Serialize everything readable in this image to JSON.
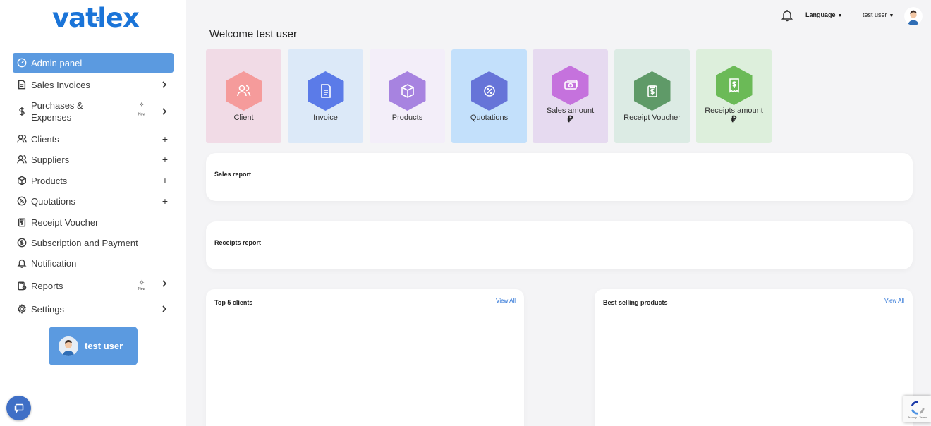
{
  "brand": {
    "logo_text_left": "vat",
    "logo_text_small": "E",
    "logo_text_right": "lex"
  },
  "sidebar": {
    "items": [
      {
        "label": "Admin panel"
      },
      {
        "label": "Sales Invoices"
      },
      {
        "label_line1": "Purchases &",
        "label_line2": "Expenses",
        "badge": "New"
      },
      {
        "label": "Clients"
      },
      {
        "label": "Suppliers"
      },
      {
        "label": "Products"
      },
      {
        "label": "Quotations"
      },
      {
        "label": "Receipt Voucher"
      },
      {
        "label": "Subscription and Payment"
      },
      {
        "label": "Notification"
      },
      {
        "label": "Reports",
        "badge": "New"
      },
      {
        "label": "Settings"
      }
    ],
    "user_card": {
      "name": "test user"
    }
  },
  "topbar": {
    "language": "Language",
    "user": "test user"
  },
  "welcome": "Welcome test user",
  "tiles": [
    {
      "label": "Client",
      "color": "#f59b9b",
      "bg": "#f1dbe6"
    },
    {
      "label": "Invoice",
      "color": "#5b7be8",
      "bg": "#dce9f8"
    },
    {
      "label": "Products",
      "color": "#a783e0",
      "bg": "#f3eef9"
    },
    {
      "label": "Quotations",
      "color": "#6674d8",
      "bg": "#c3e0fb"
    },
    {
      "label": "Sales amount",
      "currency": "⃁",
      "color": "#c572dd",
      "bg": "#e6daf0"
    },
    {
      "label": "Receipt Voucher",
      "color": "#5f9a68",
      "bg": "#dcebe4"
    },
    {
      "label": "Receipts amount",
      "currency": "⃁",
      "color": "#6bba57",
      "bg": "#ddefdc"
    }
  ],
  "cards": {
    "sales_report": "Sales report",
    "receipts_report": "Receipts report",
    "top_clients": "Top 5 clients",
    "best_products": "Best selling products",
    "view_all": "View All"
  },
  "recaptcha": {
    "text": "Privacy - Terms"
  }
}
